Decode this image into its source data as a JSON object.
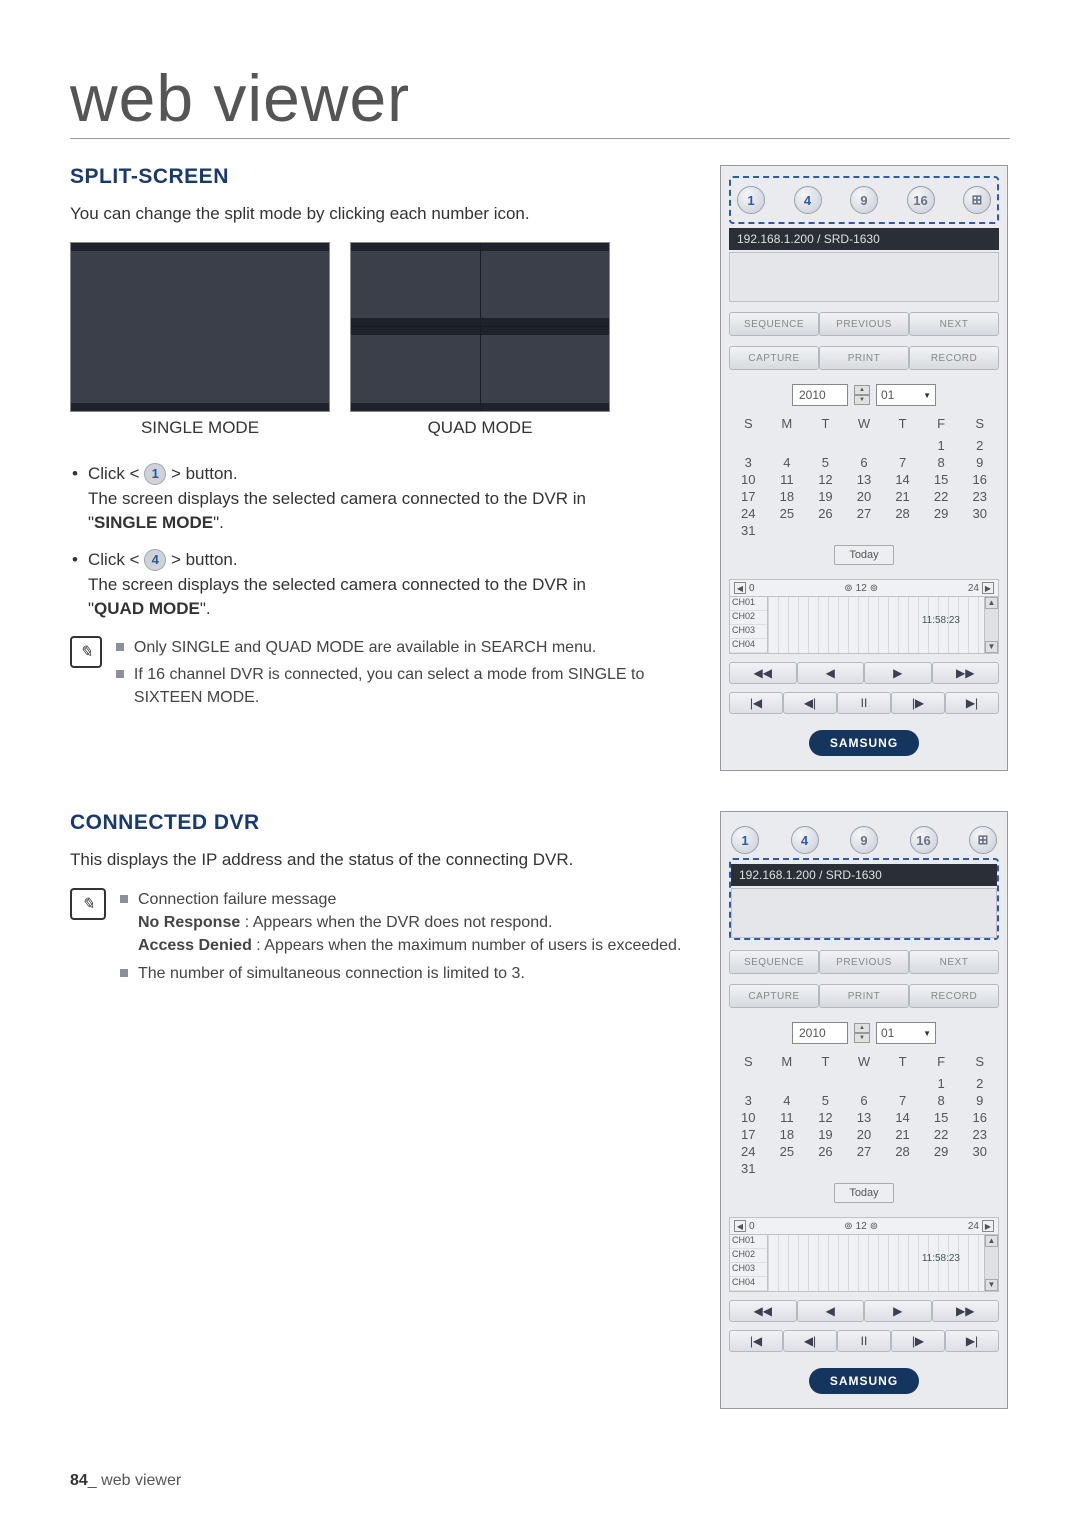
{
  "page": {
    "title": "web viewer",
    "number": "84",
    "footer_label": "web viewer"
  },
  "split": {
    "heading": "SPLIT-SCREEN",
    "intro": "You can change the split mode by clicking each number icon.",
    "single_caption": "SINGLE MODE",
    "quad_caption": "QUAD MODE",
    "click1_pre": "Click < ",
    "click1_num": "1",
    "click1_post": " > button.",
    "click1_desc_a": "The screen displays the selected camera connected to the DVR in",
    "click1_desc_b": "\"SINGLE MODE\".",
    "click4_pre": "Click < ",
    "click4_num": "4",
    "click4_post": " > button.",
    "click4_desc_a": "The screen displays the selected camera connected to the DVR in",
    "click4_desc_b": "\"QUAD MODE\".",
    "note1": "Only SINGLE and QUAD MODE are available in SEARCH menu.",
    "note2": "If 16 channel DVR is connected, you can select a mode from SINGLE to SIXTEEN MODE."
  },
  "conn": {
    "heading": "CONNECTED DVR",
    "intro": "This displays the IP address and the status of the connecting DVR.",
    "note_cfm": "Connection failure message",
    "no_response_lbl": "No Response",
    "no_response_txt": " : Appears when the DVR does not respond.",
    "access_denied_lbl": "Access Denied",
    "access_denied_txt": " : Appears when the maximum number of users is exceeded.",
    "note_limit": "The number of simultaneous connection is limited to 3."
  },
  "panel": {
    "split_values": [
      "1",
      "4",
      "9",
      "16",
      ""
    ],
    "addr": "192.168.1.200   / SRD-1630",
    "btns1": [
      "SEQUENCE",
      "PREVIOUS",
      "NEXT"
    ],
    "btns2": [
      "CAPTURE",
      "PRINT",
      "RECORD"
    ],
    "year": "2010",
    "month": "01",
    "dow": [
      "S",
      "M",
      "T",
      "W",
      "T",
      "F",
      "S"
    ],
    "weeks": [
      [
        "",
        "",
        "",
        "",
        "",
        "1",
        "2"
      ],
      [
        "3",
        "4",
        "5",
        "6",
        "7",
        "8",
        "9"
      ],
      [
        "10",
        "11",
        "12",
        "13",
        "14",
        "15",
        "16"
      ],
      [
        "17",
        "18",
        "19",
        "20",
        "21",
        "22",
        "23"
      ],
      [
        "24",
        "25",
        "26",
        "27",
        "28",
        "29",
        "30"
      ],
      [
        "31",
        "",
        "",
        "",
        "",
        "",
        ""
      ]
    ],
    "today": "Today",
    "tl_left": "0",
    "tl_mid": "12",
    "tl_right": "24",
    "tl_time": "11:58:23",
    "channels": [
      "CH01",
      "CH02",
      "CH03",
      "CH04"
    ],
    "play": [
      "◀◀",
      "◀",
      "▶",
      "▶▶"
    ],
    "play2": [
      "|◀",
      "◀|",
      "II",
      "|▶",
      "▶|"
    ],
    "brand": "SAMSUNG"
  }
}
